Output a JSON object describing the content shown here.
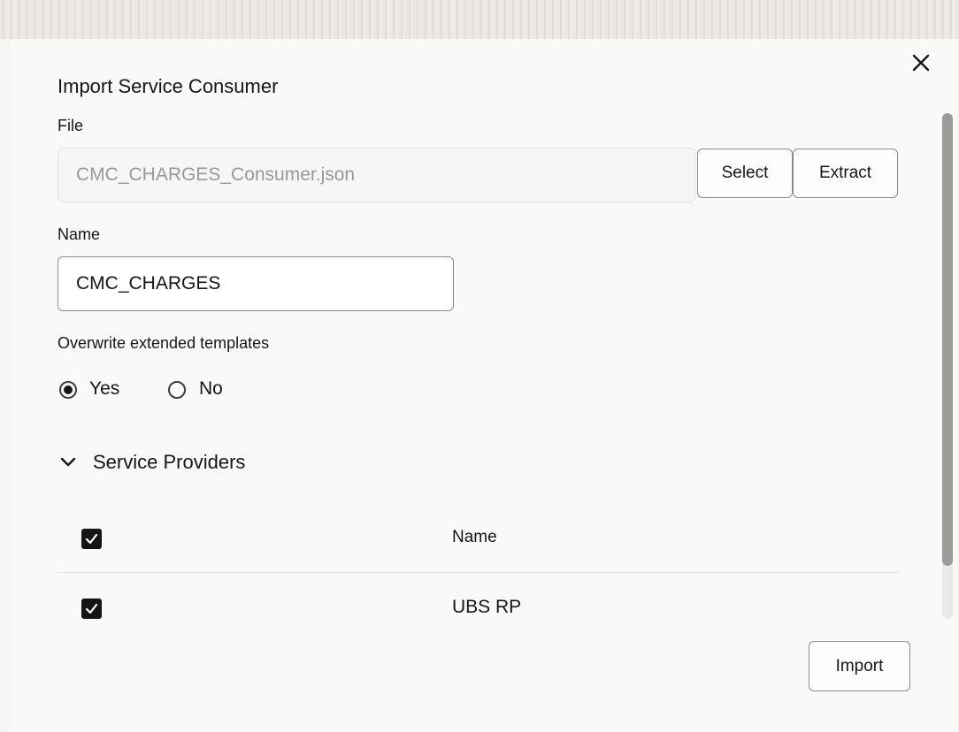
{
  "dialog": {
    "title": "Import Service Consumer",
    "close_icon": "close-icon"
  },
  "file": {
    "label": "File",
    "value": "CMC_CHARGES_Consumer.json",
    "select_label": "Select",
    "extract_label": "Extract"
  },
  "name": {
    "label": "Name",
    "value": "CMC_CHARGES"
  },
  "overwrite": {
    "label": "Overwrite extended templates",
    "options": [
      {
        "label": "Yes",
        "selected": true
      },
      {
        "label": "No",
        "selected": false
      }
    ]
  },
  "providers": {
    "section_title": "Service Providers",
    "expanded": true,
    "column_header": "Name",
    "header_checked": true,
    "rows": [
      {
        "name": "UBS RP",
        "checked": true
      }
    ]
  },
  "footer": {
    "import_label": "Import"
  },
  "colors": {
    "background": "#faf9f7",
    "text": "#161513",
    "placeholder_text": "#9a9894",
    "border": "#8e8b86",
    "checkbox_fill": "#161513"
  }
}
